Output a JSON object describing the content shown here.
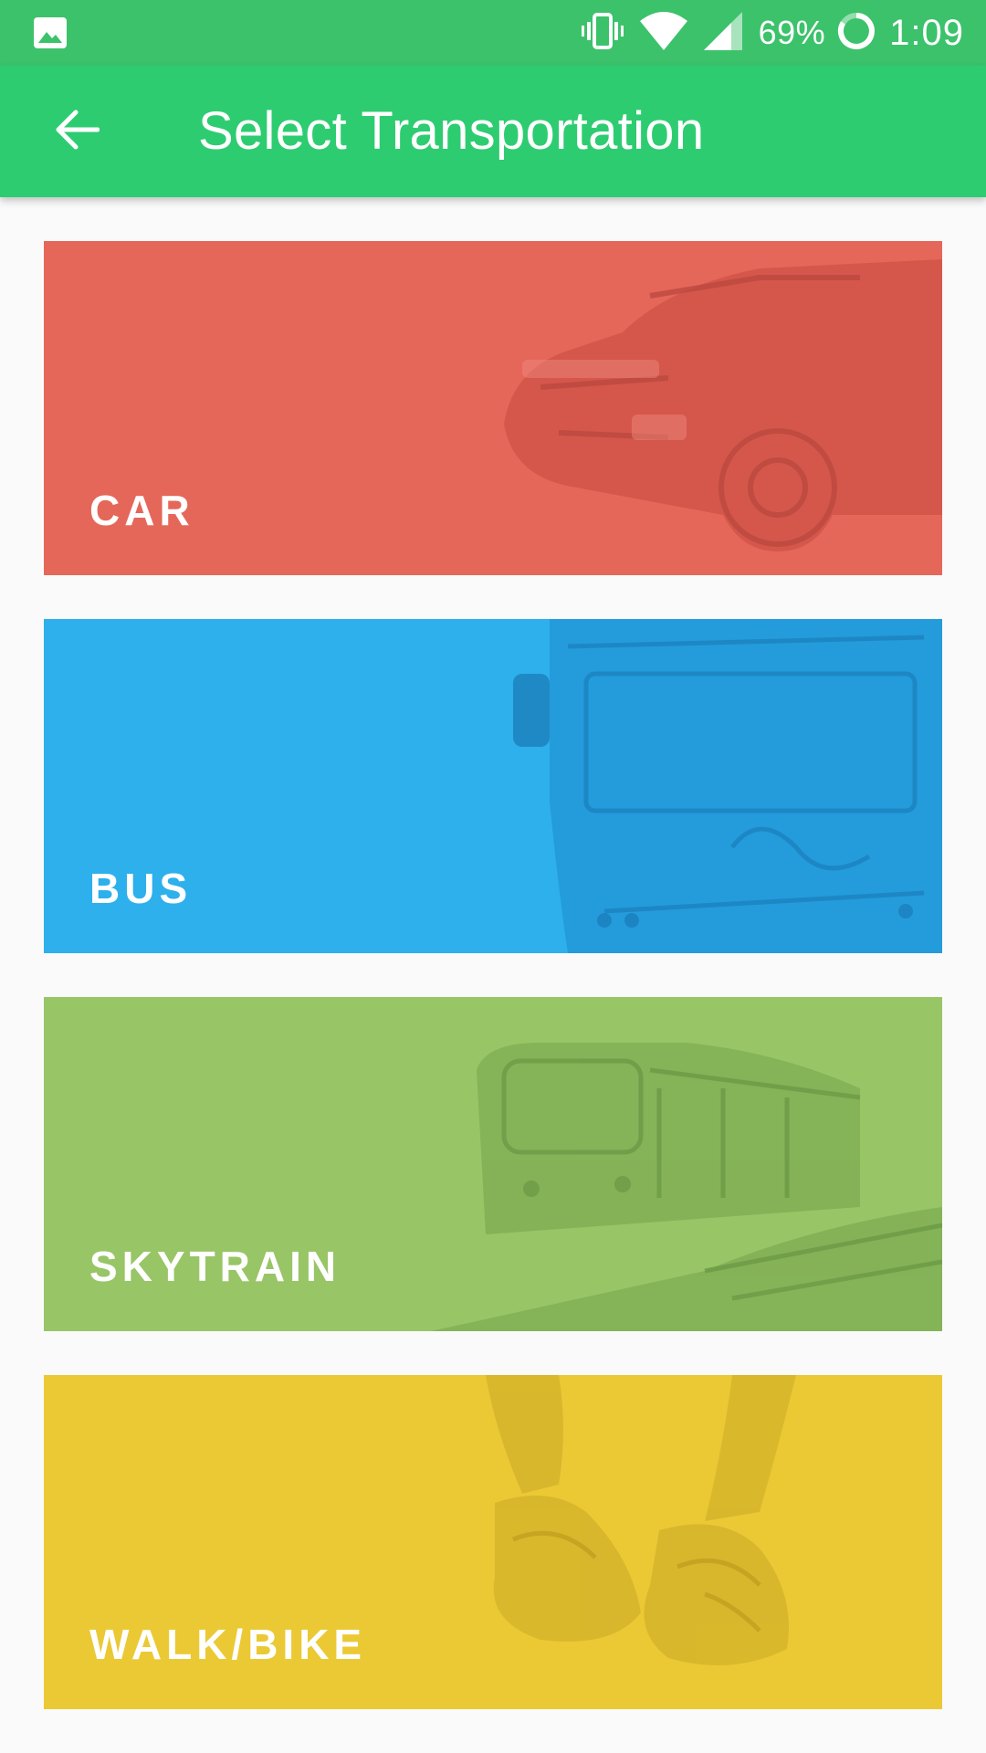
{
  "status_bar": {
    "battery": "69%",
    "time": "1:09",
    "icons": [
      "image-notification-icon",
      "vibrate-icon",
      "wifi-icon",
      "cell-signal-icon",
      "battery-icon"
    ]
  },
  "app_bar": {
    "title": "Select Transportation",
    "back_icon": "arrow-back-icon"
  },
  "options": [
    {
      "label": "CAR",
      "color": "#e5675a",
      "art": "car-image"
    },
    {
      "label": "BUS",
      "color": "#2db0eb",
      "art": "bus-image"
    },
    {
      "label": "SKYTRAIN",
      "color": "#98c566",
      "art": "skytrain-image"
    },
    {
      "label": "WALK/BIKE",
      "color": "#ebc935",
      "art": "sneakers-image"
    }
  ]
}
